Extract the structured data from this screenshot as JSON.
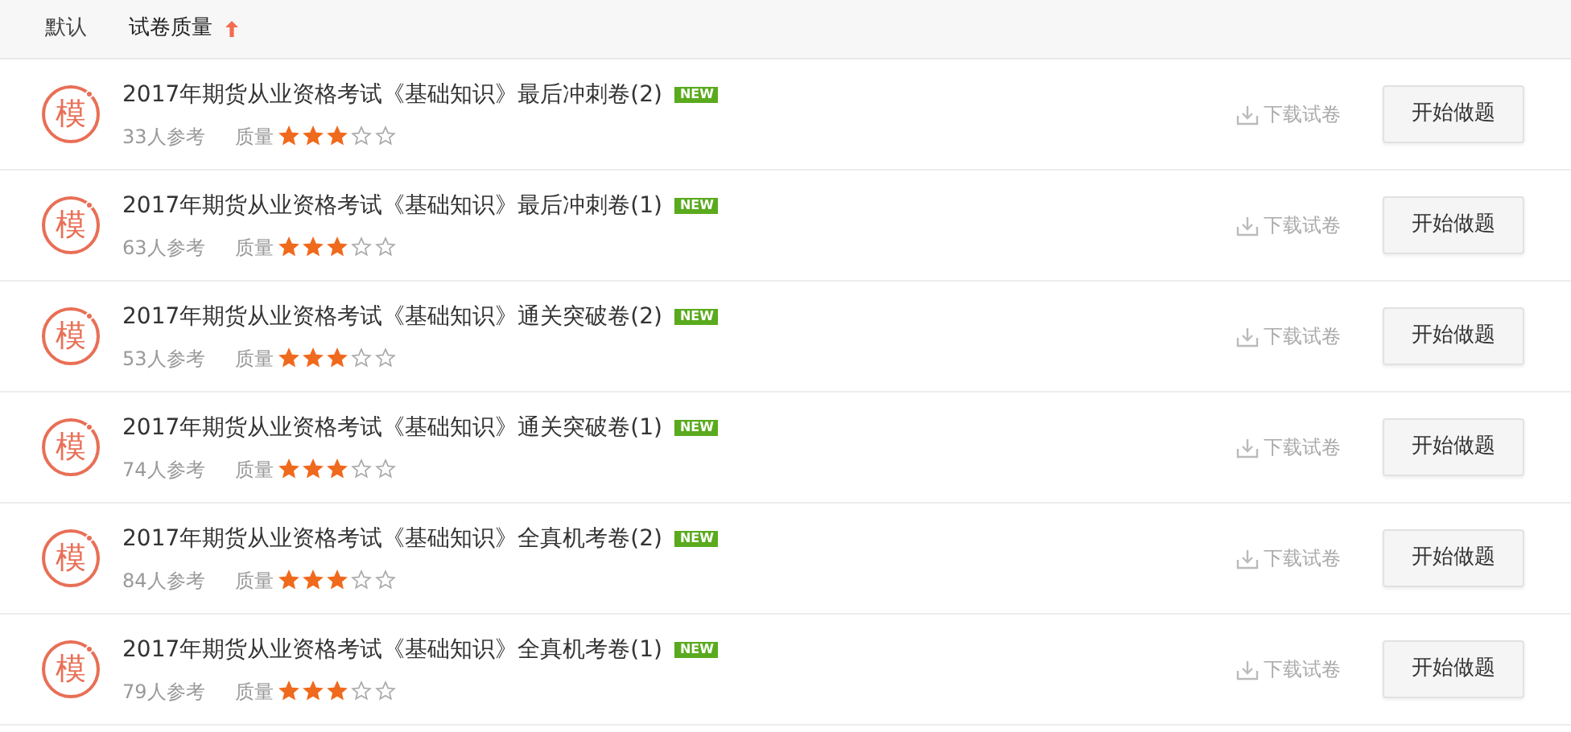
{
  "sort_options": [
    {
      "label": "默认",
      "selected": false
    },
    {
      "label": "试卷质量",
      "selected": true
    }
  ],
  "papers": [
    {
      "badge": "模",
      "title": "2017年期货从业资格考试《基础知识》最后冲刺卷(2)",
      "tag": "NEW",
      "participants": "33人参考",
      "quality_label": "质量",
      "stars": 3,
      "download": "下载试卷",
      "start": "开始做题"
    },
    {
      "badge": "模",
      "title": "2017年期货从业资格考试《基础知识》最后冲刺卷(1)",
      "tag": "NEW",
      "participants": "63人参考",
      "quality_label": "质量",
      "stars": 3,
      "download": "下载试卷",
      "start": "开始做题"
    },
    {
      "badge": "模",
      "title": "2017年期货从业资格考试《基础知识》通关突破卷(2)",
      "tag": "NEW",
      "participants": "53人参考",
      "quality_label": "质量",
      "stars": 3,
      "download": "下载试卷",
      "start": "开始做题"
    },
    {
      "badge": "模",
      "title": "2017年期货从业资格考试《基础知识》通关突破卷(1)",
      "tag": "NEW",
      "participants": "74人参考",
      "quality_label": "质量",
      "stars": 3,
      "download": "下载试卷",
      "start": "开始做题"
    },
    {
      "badge": "模",
      "title": "2017年期货从业资格考试《基础知识》全真机考卷(2)",
      "tag": "NEW",
      "participants": "84人参考",
      "quality_label": "质量",
      "stars": 3,
      "download": "下载试卷",
      "start": "开始做题"
    },
    {
      "badge": "模",
      "title": "2017年期货从业资格考试《基础知识》全真机考卷(1)",
      "tag": "NEW",
      "participants": "79人参考",
      "quality_label": "质量",
      "stars": 3,
      "download": "下载试卷",
      "start": "开始做题"
    }
  ]
}
